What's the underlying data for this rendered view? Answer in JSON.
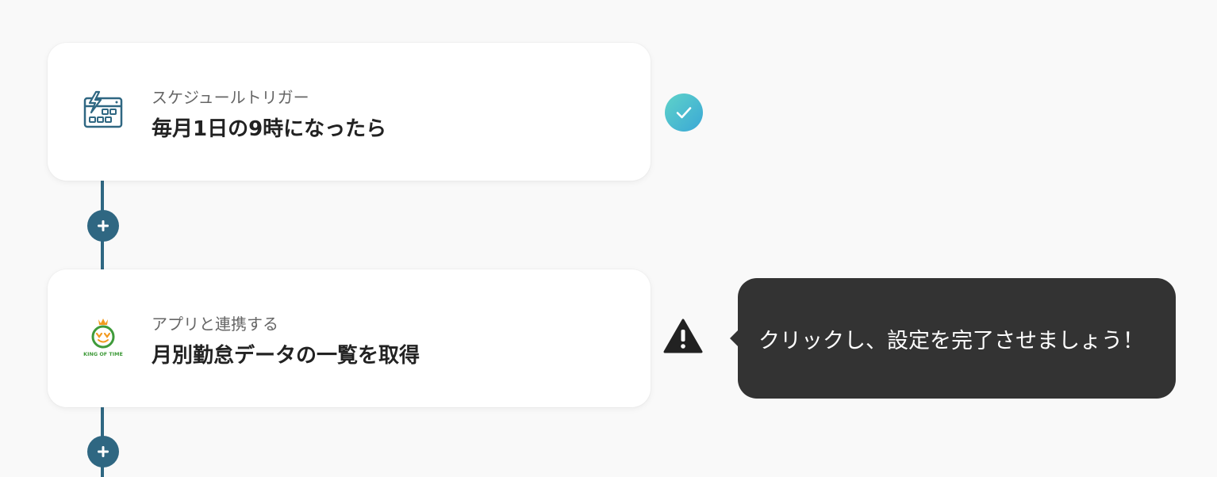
{
  "flow": {
    "steps": [
      {
        "subtitle": "スケジュールトリガー",
        "title": "毎月1日の9時になったら",
        "icon": "schedule-trigger-icon",
        "status": "complete"
      },
      {
        "subtitle": "アプリと連携する",
        "title": "月別勤怠データの一覧を取得",
        "icon": "king-of-time-logo",
        "status": "warning"
      }
    ],
    "add_step_icon": "plus-icon"
  },
  "tooltip": {
    "text": "クリックし、設定を完了させましょう！"
  },
  "logo": {
    "king_of_time_text": "KING OF TIME"
  },
  "colors": {
    "background": "#f9f9f9",
    "connector": "#2f6782",
    "check_gradient_start": "#5fd3c9",
    "check_gradient_end": "#3aa7d6",
    "warning": "#222222",
    "tooltip_bg": "#333333",
    "logo_green": "#3f9b3a",
    "logo_orange": "#f29a1f"
  }
}
